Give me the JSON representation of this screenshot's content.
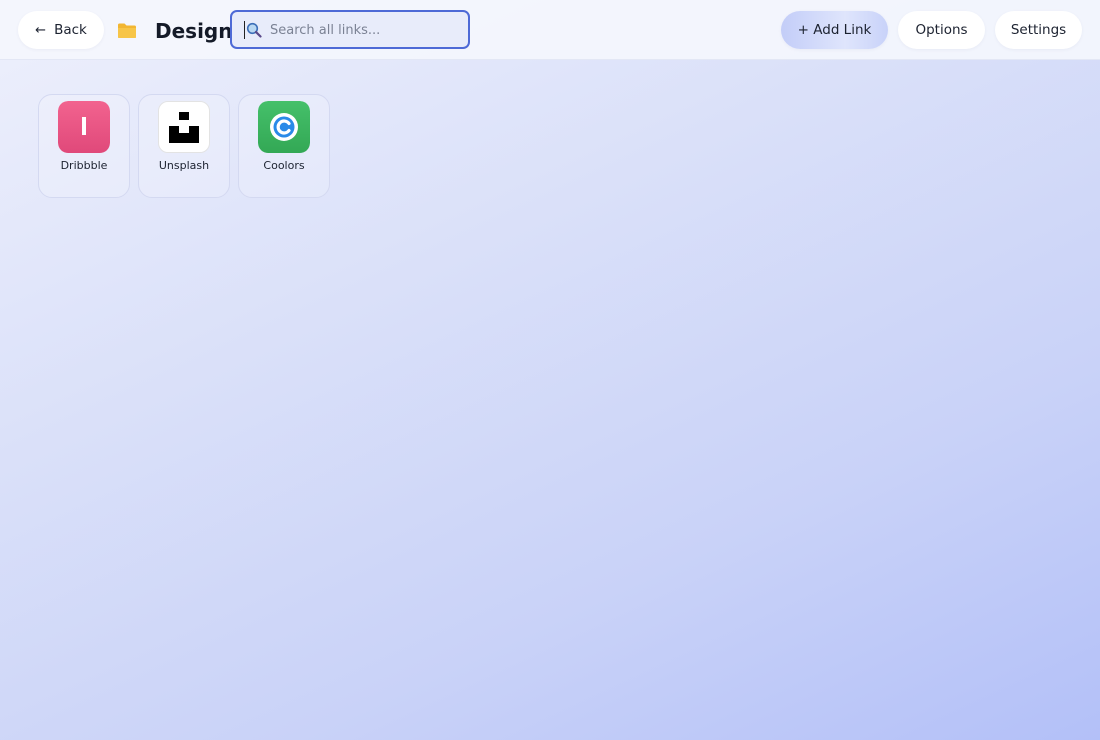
{
  "header": {
    "back_label": "Back",
    "back_arrow": "←",
    "folder_icon": "folder-icon",
    "title": "Design",
    "search": {
      "placeholder": "Search all links...",
      "value": ""
    },
    "add_link_label": "+ Add Link",
    "options_label": "Options",
    "settings_label": "Settings"
  },
  "links": [
    {
      "name": "Dribbble",
      "icon": "dribbble-icon",
      "icon_color": "#ea4c89"
    },
    {
      "name": "Unsplash",
      "icon": "unsplash-icon",
      "icon_color": "#000000"
    },
    {
      "name": "Coolors",
      "icon": "coolors-icon",
      "icon_color": "#3fb55e"
    }
  ],
  "colors": {
    "accent": "#4e6ad6",
    "folder": "#f7c548"
  }
}
